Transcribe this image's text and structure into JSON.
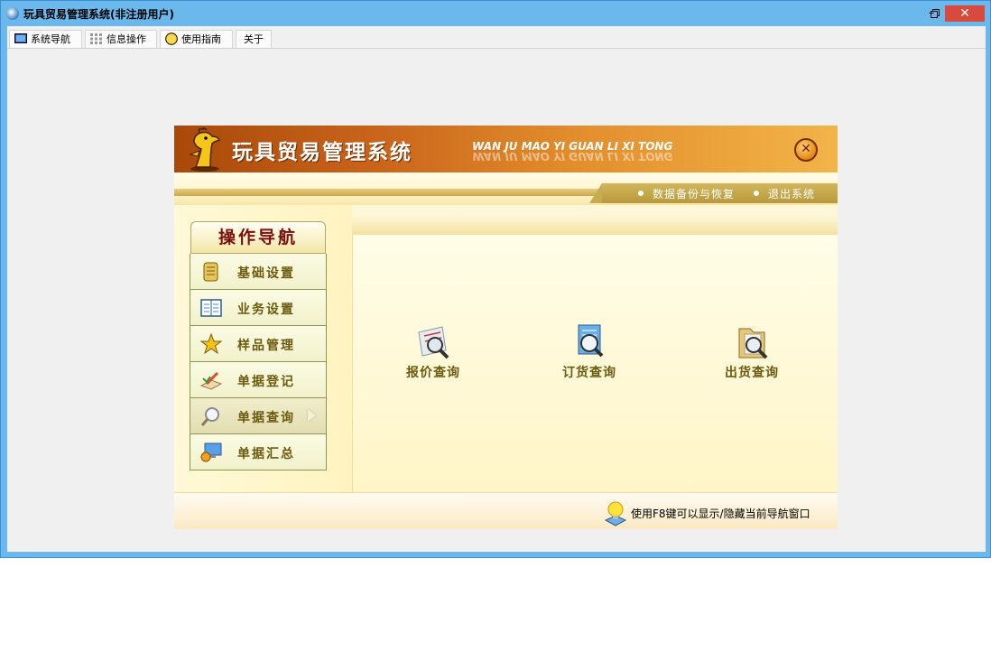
{
  "window": {
    "title": "玩具贸易管理系统(非注册用户)",
    "min_glyph": "–",
    "max_glyph": "❐",
    "close_glyph": "✕"
  },
  "menu": {
    "items": [
      {
        "label": "系统导航",
        "icon": "monitor-icon"
      },
      {
        "label": "信息操作",
        "icon": "grid-icon"
      },
      {
        "label": "使用指南",
        "icon": "smiley-icon"
      },
      {
        "label": "关于",
        "icon": ""
      }
    ]
  },
  "banner": {
    "title": "玩具贸易管理系统",
    "subtitle": "WAN JU MAO YI GUAN LI XI TONG",
    "close_glyph": "✕"
  },
  "toolbar": {
    "backup": "数据备份与恢复",
    "exit": "退出系统"
  },
  "side": {
    "header": "操作导航",
    "items": [
      {
        "label": "基础设置",
        "icon": "scroll-icon"
      },
      {
        "label": "业务设置",
        "icon": "book-icon"
      },
      {
        "label": "样品管理",
        "icon": "star-icon"
      },
      {
        "label": "单据登记",
        "icon": "pen-icon"
      },
      {
        "label": "单据查询",
        "icon": "magnifier-icon"
      },
      {
        "label": "单据汇总",
        "icon": "computer-icon"
      }
    ]
  },
  "content": {
    "buttons": [
      {
        "label": "报价查询",
        "icon": "quote-search-icon"
      },
      {
        "label": "订货查询",
        "icon": "order-search-icon"
      },
      {
        "label": "出货查询",
        "icon": "shipment-search-icon"
      }
    ]
  },
  "footer": {
    "hint": "使用F8键可以显示/隐藏当前导航窗口"
  },
  "colors": {
    "titlebar": "#6ab8ec",
    "banner_orange": "#c9641a",
    "nav_text": "#6b5a10",
    "header_text": "#7a1010",
    "close_red": "#d94a3e"
  }
}
